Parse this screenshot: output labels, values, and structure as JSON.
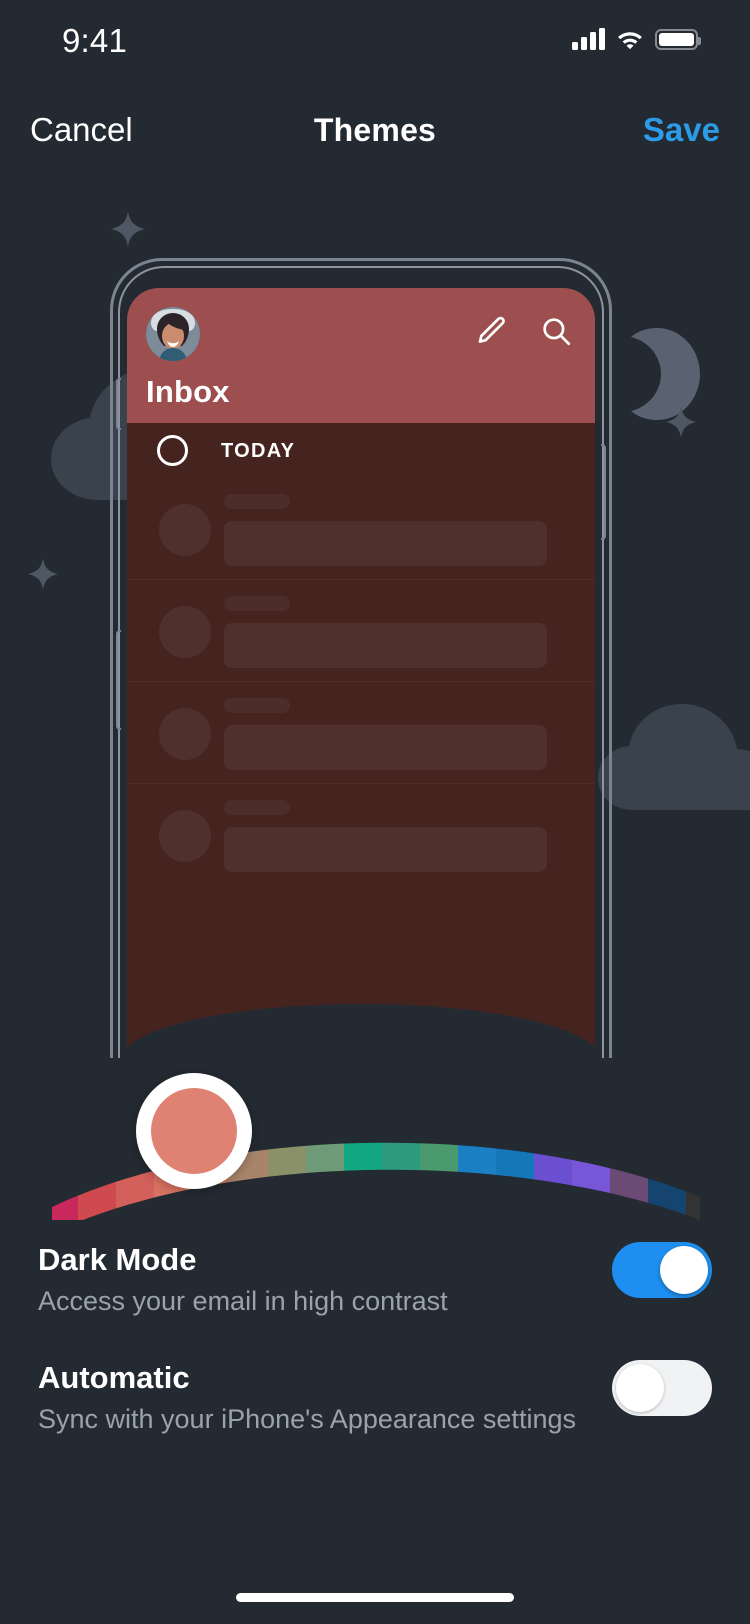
{
  "status_bar": {
    "time": "9:41",
    "icons": [
      "cellular-signal-icon",
      "wifi-icon",
      "battery-icon"
    ]
  },
  "nav": {
    "cancel_label": "Cancel",
    "title": "Themes",
    "save_label": "Save",
    "save_color": "#2c9ce8"
  },
  "preview": {
    "header_color": "#9d4f4f",
    "list_background": "#452420",
    "avatar_name": "user-avatar-photo",
    "inbox_title": "Inbox",
    "section_label": "TODAY",
    "header_icons": [
      "compose-pencil-icon",
      "search-icon"
    ],
    "placeholder_rows": 4
  },
  "color_picker": {
    "selected_color": "#e08273",
    "selected_index": 2,
    "swatches": [
      "#c9285c",
      "#ce4a4e",
      "#e08273",
      "#c07a5f",
      "#8a9168",
      "#6e9a78",
      "#13a883",
      "#4a9a6e",
      "#1b7fc4",
      "#1576b8",
      "#6a4fd0",
      "#7757d8",
      "#6b4a76",
      "#15456e",
      "#1b4a72",
      "#333333",
      "#2a2a2a",
      "#000000"
    ]
  },
  "settings": [
    {
      "title": "Dark Mode",
      "subtitle": "Access your email in high contrast",
      "enabled": true,
      "on_color": "#1e8ff0"
    },
    {
      "title": "Automatic",
      "subtitle": "Sync with your iPhone's Appearance settings",
      "enabled": false,
      "off_color": "#f1f2f4"
    }
  ],
  "background": {
    "page_color": "#242a32",
    "decor_color": "#39424d",
    "decorations": [
      "sparkle-icon",
      "cloud-icon",
      "moon-icon",
      "sparkle-icon",
      "sparkle-icon",
      "cloud-icon"
    ]
  },
  "home_indicator": "home-indicator"
}
